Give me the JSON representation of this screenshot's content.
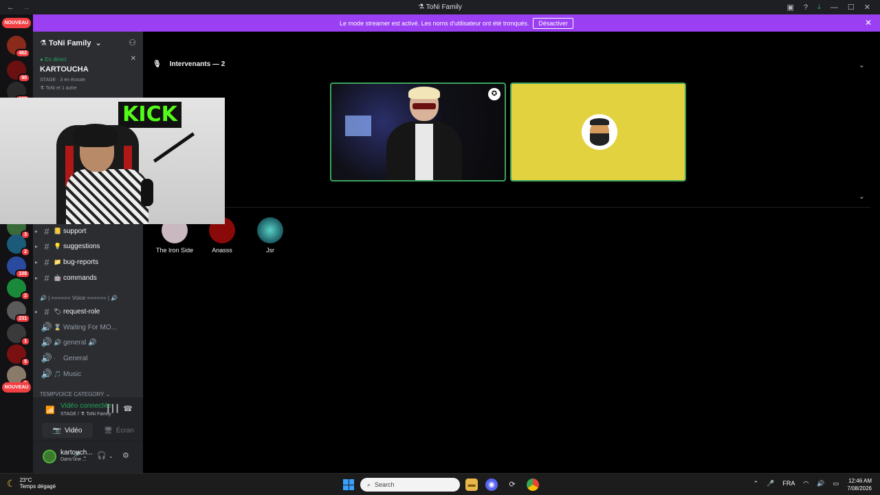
{
  "window": {
    "title": "⚗ ToNi Family",
    "nav_back": "←",
    "nav_forward": "→"
  },
  "banner": {
    "message": "Le mode streamer est activé. Les noms d'utilisateur ont été tronqués.",
    "button": "Désactiver"
  },
  "guilds": {
    "nouveau_top": "NOUVEAU",
    "nouveau_bottom": "NOUVEAU",
    "badges": [
      "462",
      "90",
      "199",
      "3",
      "2",
      "109",
      "2",
      "231",
      "1",
      "5",
      "1"
    ]
  },
  "server": {
    "name": "⚗ ToNi Family",
    "live_label": "En direct",
    "live_user": "KARTOUCHA",
    "live_meta": "STAGE · 3 en écoute",
    "live_meta2": "⚗ ToNi et 1 autre"
  },
  "channels": [
    {
      "emoji": "📒",
      "name": "support",
      "type": "text"
    },
    {
      "emoji": "💡",
      "name": "suggestions",
      "type": "text"
    },
    {
      "emoji": "📁",
      "name": "bug-reports",
      "type": "text"
    },
    {
      "emoji": "🤖",
      "name": "commands",
      "type": "text"
    }
  ],
  "voice_category": "🔊 | ====== Voice ====== | 🔊",
  "channels2": [
    {
      "emoji": "🏷",
      "name": "request-role",
      "type": "text"
    },
    {
      "emoji": "⌛",
      "name": "Waiting For MO...",
      "type": "voice"
    },
    {
      "emoji": "🔊",
      "name": "general 🔊",
      "type": "voice"
    },
    {
      "emoji": "·",
      "name": "General",
      "type": "voice"
    },
    {
      "emoji": "🎵",
      "name": "Music",
      "type": "voice"
    }
  ],
  "temp_category": "TEMPVOICE CATEGORY",
  "voice": {
    "status": "Vidéo connectée",
    "sub": "STAGE / ⚗ ToNi Family",
    "video_btn": "Vidéo",
    "screen_btn": "Écran"
  },
  "user": {
    "name": "kartouch...",
    "status": "Dans une ..."
  },
  "stage": {
    "speakers_label": "Intervenants — 2",
    "audience": [
      "The Iron Side",
      "Anasss",
      "Jsr"
    ]
  },
  "webcam": {
    "sign": "KICK"
  },
  "taskbar": {
    "temp": "23°C",
    "weather": "Temps dégagé",
    "search": "Search",
    "lang": "FRA",
    "time": "12:46 AM",
    "date": "7/08/2026"
  }
}
